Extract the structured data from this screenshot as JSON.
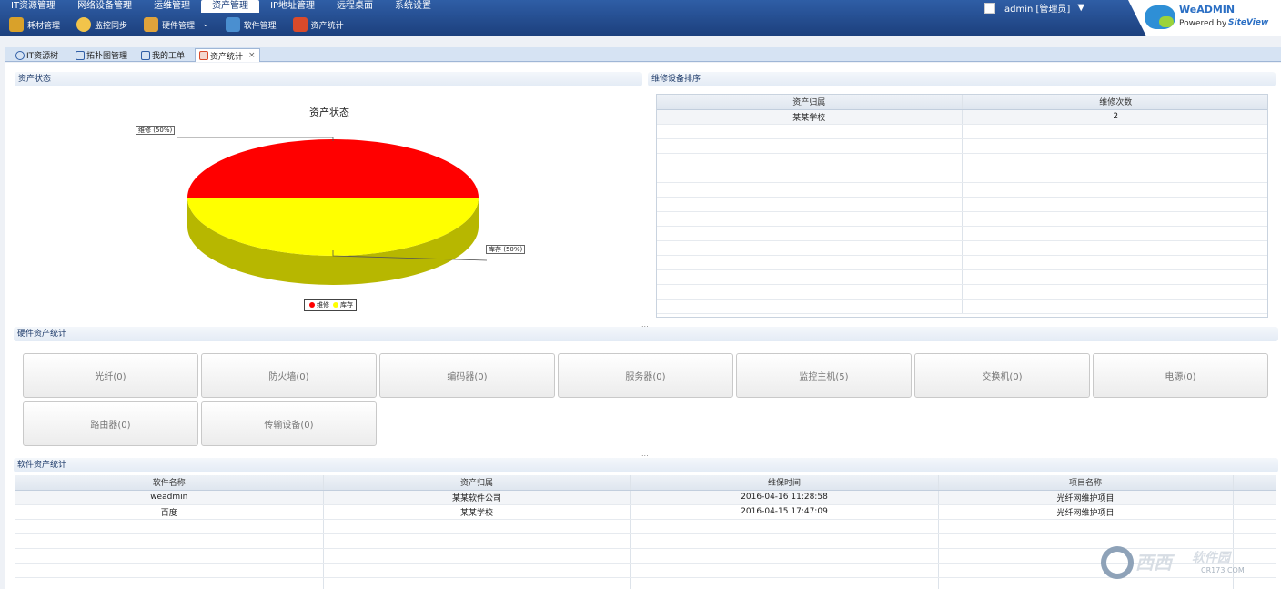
{
  "topnav": {
    "items": [
      "IT资源管理",
      "网络设备管理",
      "运维管理",
      "资产管理",
      "IP地址管理",
      "远程桌面",
      "系统设置"
    ],
    "active": "资产管理"
  },
  "subnav": {
    "items": [
      {
        "label": "耗材管理",
        "icon": "consumables-icon",
        "color": "#d9a12a"
      },
      {
        "label": "监控同步",
        "icon": "sync-icon",
        "color": "#f2c44a"
      },
      {
        "label": "硬件管理",
        "icon": "hardware-icon",
        "color": "#e0a33b"
      },
      {
        "label": "软件管理",
        "icon": "software-icon",
        "color": "#4a8fd0"
      },
      {
        "label": "资产统计",
        "icon": "statistics-icon",
        "color": "#d94a2a"
      }
    ],
    "dropdown_glyph": "⌄"
  },
  "user": {
    "label": "admin [管理员]",
    "caret": "▼"
  },
  "brand": {
    "name": "WeADMIN",
    "powered": "Powered by",
    "vendor": "SiteView"
  },
  "tabs": [
    {
      "label": "IT资源树",
      "active": false
    },
    {
      "label": "拓扑图管理",
      "active": false
    },
    {
      "label": "我的工单",
      "active": false
    },
    {
      "label": "资产统计",
      "active": true,
      "close": "×"
    }
  ],
  "asset_status": {
    "panel_title": "资产状态",
    "chart_title": "资产状态",
    "callout_repair": "维修 (50%)",
    "callout_stock": "库存 (50%)",
    "legend": [
      "维修",
      "库存"
    ]
  },
  "chart_data": {
    "type": "pie",
    "title": "资产状态",
    "categories": [
      "维修",
      "库存"
    ],
    "values": [
      50,
      50
    ],
    "colors": [
      "#ff0000",
      "#ffff00"
    ],
    "legend_position": "bottom"
  },
  "repair_ranking": {
    "panel_title": "维修设备排序",
    "columns": [
      "资产归属",
      "维修次数"
    ],
    "rows": [
      [
        "某某学校",
        "2"
      ]
    ],
    "empty_rows": 13
  },
  "hardware": {
    "panel_title": "硬件资产统计",
    "buttons": [
      "光纤(0)",
      "防火墙(0)",
      "编码器(0)",
      "服务器(0)",
      "监控主机(5)",
      "交换机(0)",
      "电源(0)",
      "路由器(0)",
      "传输设备(0)"
    ]
  },
  "software": {
    "panel_title": "软件资产统计",
    "columns": [
      "软件名称",
      "资产归属",
      "维保时间",
      "项目名称"
    ],
    "rows": [
      [
        "weadmin",
        "某某软件公司",
        "2016-04-16 11:28:58",
        "光纤网维护项目"
      ],
      [
        "百度",
        "某某学校",
        "2016-04-15 17:47:09",
        "光纤网维护项目"
      ]
    ],
    "empty_rows": 5
  },
  "splitter": "...",
  "watermark": {
    "brand": "西西",
    "cn": "软件园",
    "domain": "CR173.COM"
  }
}
